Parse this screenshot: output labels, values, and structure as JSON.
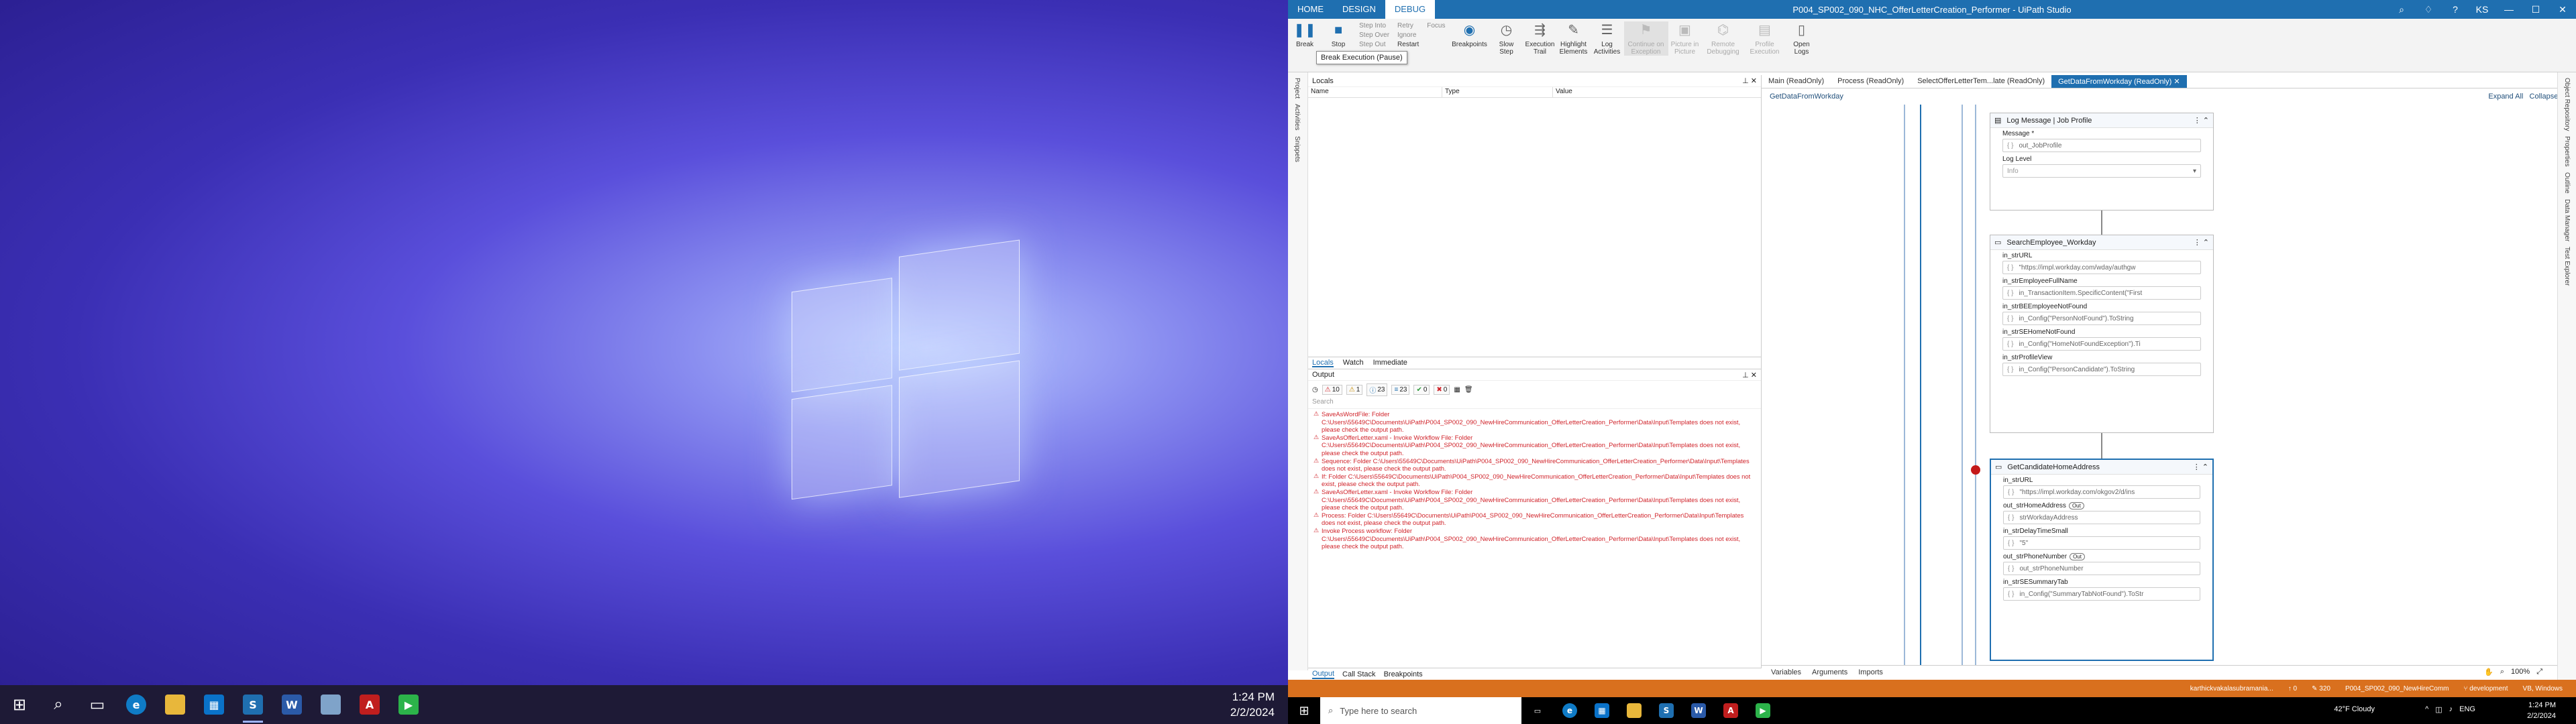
{
  "left_monitor": {
    "taskbar": {
      "icons": [
        "windows-icon",
        "search-icon",
        "task-view-icon",
        "edge-icon",
        "file-explorer-icon",
        "store-icon",
        "uipath-studio-icon",
        "word-icon",
        "notepad-icon",
        "acrobat-icon",
        "media-player-icon"
      ],
      "time": "1:24 PM",
      "date": "2/2/2024"
    }
  },
  "app": {
    "title": "P004_SP002_090_NHC_OfferLetterCreation_Performer - UiPath Studio",
    "menu_tabs": [
      "HOME",
      "DESIGN",
      "DEBUG"
    ],
    "active_menu": "DEBUG",
    "user_initials": "KS",
    "ribbon": {
      "break_label": "Break",
      "stop_label": "Stop",
      "step_into": "Step Into",
      "step_over": "Step Over",
      "step_out": "Step Out",
      "retry": "Retry",
      "ignore": "Ignore",
      "restart": "Restart",
      "focus": "Focus",
      "breakpoints": "Breakpoints",
      "slow_step": "Slow\nStep",
      "execution_trail": "Execution\nTrail",
      "highlight_elements": "Highlight\nElements",
      "log_activities": "Log\nActivities",
      "continue_on_exception": "Continue on\nException",
      "picture_in_picture": "Picture in\nPicture",
      "remote_debugging": "Remote\nDebugging",
      "profile_execution": "Profile\nExecution",
      "open_logs": "Open\nLogs",
      "tooltip": "Break Execution (Pause)"
    },
    "left_side_tabs": [
      "Project",
      "Activities",
      "Snippets"
    ],
    "right_side_tabs": [
      "Object Repository",
      "Properties",
      "Outline",
      "Data Manager",
      "Test Explorer"
    ],
    "locals": {
      "title": "Locals",
      "columns": [
        "Name",
        "Type",
        "Value"
      ],
      "tabs": [
        "Locals",
        "Watch",
        "Immediate"
      ]
    },
    "output": {
      "title": "Output",
      "filter_counts": [
        "10",
        "1",
        "23",
        "23",
        "0",
        "0"
      ],
      "search_placeholder": "Search",
      "lines": [
        "SaveAsWordFile: Folder C:\\Users\\55649C\\Documents\\UiPath\\P004_SP002_090_NewHireCommunication_OfferLetterCreation_Performer\\Data\\Input\\Templates does not exist, please check the output path.",
        "SaveAsOfferLetter.xaml - Invoke Workflow File: Folder C:\\Users\\55649C\\Documents\\UiPath\\P004_SP002_090_NewHireCommunication_OfferLetterCreation_Performer\\Data\\Input\\Templates does not exist, please check the output path.",
        "Sequence: Folder C:\\Users\\55649C\\Documents\\UiPath\\P004_SP002_090_NewHireCommunication_OfferLetterCreation_Performer\\Data\\Input\\Templates does not exist, please check the output path.",
        "If: Folder C:\\Users\\55649C\\Documents\\UiPath\\P004_SP002_090_NewHireCommunication_OfferLetterCreation_Performer\\Data\\Input\\Templates does not exist, please check the output path.",
        "SaveAsOfferLetter.xaml - Invoke Workflow File: Folder C:\\Users\\55649C\\Documents\\UiPath\\P004_SP002_090_NewHireCommunication_OfferLetterCreation_Performer\\Data\\Input\\Templates does not exist, please check the output path.",
        "Process: Folder C:\\Users\\55649C\\Documents\\UiPath\\P004_SP002_090_NewHireCommunication_OfferLetterCreation_Performer\\Data\\Input\\Templates does not exist, please check the output path.",
        "Invoke Process workflow: Folder C:\\Users\\55649C\\Documents\\UiPath\\P004_SP002_090_NewHireCommunication_OfferLetterCreation_Performer\\Data\\Input\\Templates does not exist, please check the output path."
      ],
      "bottom_tabs": [
        "Output",
        "Call Stack",
        "Breakpoints"
      ]
    },
    "doc_tabs": [
      "Main (ReadOnly)",
      "Process (ReadOnly)",
      "SelectOfferLetterTem...late (ReadOnly)",
      "GetDataFromWorkday (ReadOnly)"
    ],
    "active_doc_tab": "GetDataFromWorkday (ReadOnly)",
    "breadcrumb": "GetDataFromWorkday",
    "expand_all": "Expand All",
    "collapse_all": "Collapse All",
    "activities": {
      "log": {
        "title": "Log Message | Job Profile",
        "message_label": "Message *",
        "message_value": "out_JobProfile",
        "level_label": "Log Level",
        "level_value": "Info"
      },
      "search": {
        "title": "SearchEmployee_Workday",
        "args": [
          {
            "label": "in_strURL",
            "value": "\"https://impl.workday.com/wday/authgw"
          },
          {
            "label": "in_strEmployeeFullName",
            "value": "in_TransactionItem.SpecificContent(\"First"
          },
          {
            "label": "in_strBEEmployeeNotFound",
            "value": "in_Config(\"PersonNotFound\").ToString"
          },
          {
            "label": "in_strSEHomeNotFound",
            "value": "in_Config(\"HomeNotFoundException\").Ti"
          },
          {
            "label": "in_strProfileView",
            "value": "in_Config(\"PersonCandidate\").ToString"
          }
        ]
      },
      "address": {
        "title": "GetCandidateHomeAddress",
        "args": [
          {
            "label": "in_strURL",
            "value": "\"https://impl.workday.com/okgov2/d/ins",
            "out": false
          },
          {
            "label": "out_strHomeAddress",
            "value": "strWorkdayAddress",
            "out": true
          },
          {
            "label": "in_strDelayTimeSmall",
            "value": "\"5\"",
            "out": false
          },
          {
            "label": "out_strPhoneNumber",
            "value": "out_strPhoneNumber",
            "out": true
          },
          {
            "label": "in_strSESummaryTab",
            "value": "in_Config(\"SummaryTabNotFound\").ToStr",
            "out": false
          }
        ],
        "out_tag": "Out"
      }
    },
    "canvas_bottom_tabs": [
      "Variables",
      "Arguments",
      "Imports"
    ],
    "zoom": "100%",
    "status": {
      "user": "karthickvakalasubramania...",
      "errors": "0",
      "count": "320",
      "project": "P004_SP002_090_NewHireComm",
      "branch": "development",
      "target": "VB, Windows"
    }
  },
  "right_taskbar": {
    "search_placeholder": "Type here to search",
    "weather": "42°F  Cloudy",
    "lang": "ENG",
    "time": "1:24 PM",
    "date": "2/2/2024"
  },
  "colors": {
    "accent": "#1f6fb0",
    "status": "#d9701e",
    "error": "#d0232a"
  }
}
